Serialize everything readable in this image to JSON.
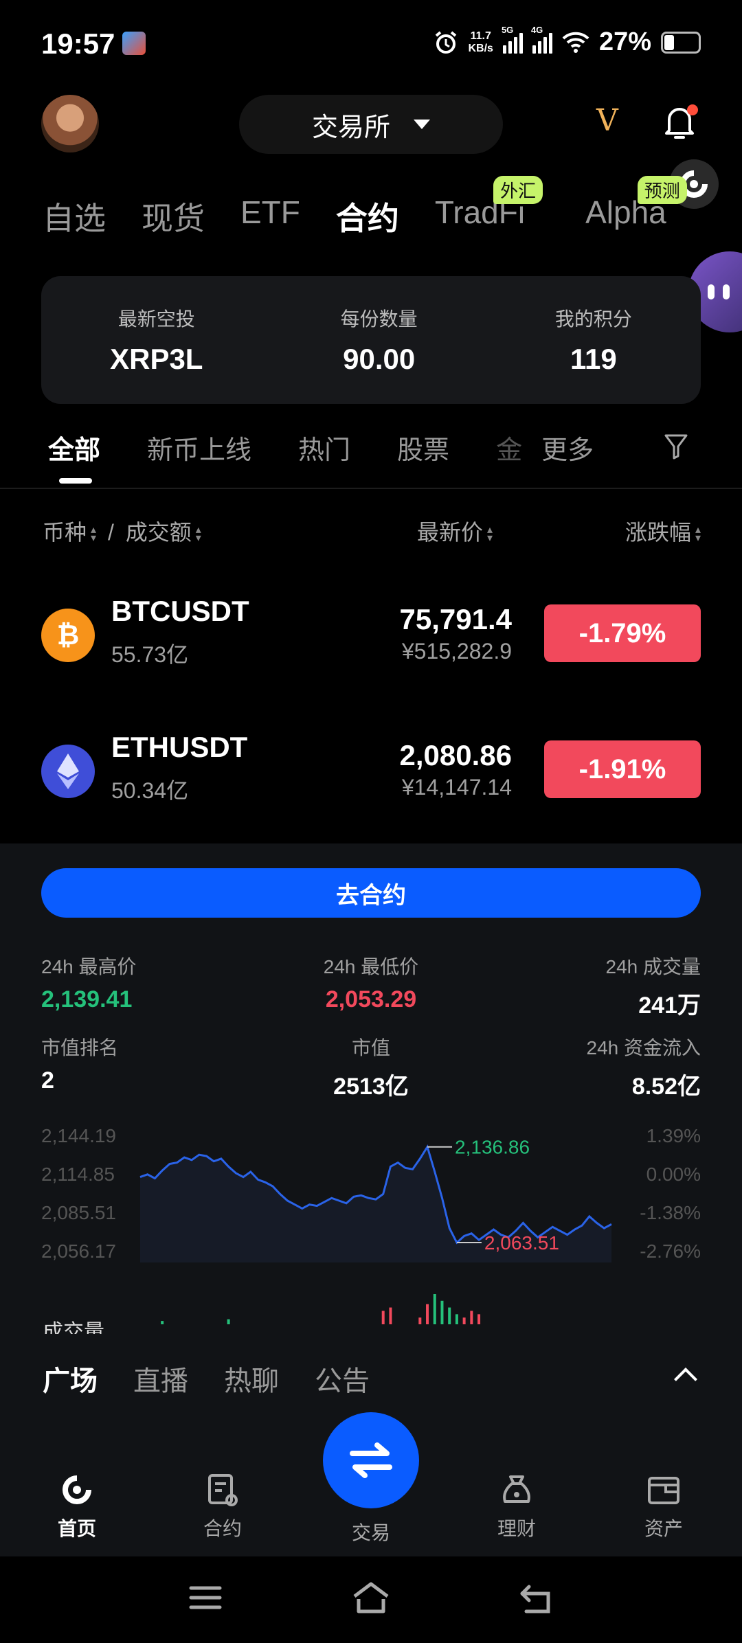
{
  "status_bar": {
    "time": "19:57",
    "net_speed_value": "11.7",
    "net_speed_unit": "KB/s",
    "sig1": "5G",
    "sig2": "4G",
    "battery": "27%"
  },
  "header": {
    "exchange_label": "交易所",
    "brand_mark": "V"
  },
  "market_tabs": [
    {
      "label": "自选"
    },
    {
      "label": "现货"
    },
    {
      "label": "ETF"
    },
    {
      "label": "合约",
      "active": true
    },
    {
      "label": "TradFi",
      "badge": "外汇"
    },
    {
      "label": "Alpha",
      "badge": "预测"
    }
  ],
  "airdrop": {
    "col1_label": "最新空投",
    "col1_value": "XRP3L",
    "col2_label": "每份数量",
    "col2_value": "90.00",
    "col3_label": "我的积分",
    "col3_value": "119"
  },
  "category_tabs": [
    "全部",
    "新币上线",
    "热门",
    "股票",
    "金",
    "更多"
  ],
  "list_header": {
    "coin": "币种",
    "sep": "/",
    "turnover": "成交额",
    "price": "最新价",
    "change": "涨跌幅"
  },
  "rows": [
    {
      "symbol": "BTCUSDT",
      "turnover": "55.73亿",
      "price": "75,791.4",
      "cny": "¥515,282.9",
      "change": "-1.79%"
    },
    {
      "symbol": "ETHUSDT",
      "turnover": "50.34亿",
      "price": "2,080.86",
      "cny": "¥14,147.14",
      "change": "-1.91%"
    }
  ],
  "detail": {
    "go_button": "去合约",
    "high_label": "24h 最高价",
    "high_value": "2,139.41",
    "low_label": "24h 最低价",
    "low_value": "2,053.29",
    "vol_label": "24h 成交量",
    "vol_value": "241万",
    "rank_label": "市值排名",
    "rank_value": "2",
    "cap_label": "市值",
    "cap_value": "2513亿",
    "inflow_label": "24h 资金流入",
    "inflow_value": "8.52亿",
    "volume_title": "成交量"
  },
  "chart_data": {
    "type": "line",
    "y_ticks_left": [
      "2,144.19",
      "2,114.85",
      "2,085.51",
      "2,056.17"
    ],
    "y_ticks_right": [
      "1.39%",
      "0.00%",
      "-1.38%",
      "-2.76%"
    ],
    "ylim": [
      2056.17,
      2144.19
    ],
    "annotations": [
      {
        "label": "2,136.86",
        "kind": "max"
      },
      {
        "label": "2,063.51",
        "kind": "min"
      }
    ],
    "series": [
      {
        "values": [
          2114,
          2116,
          2113,
          2119,
          2124,
          2125,
          2129,
          2127,
          2131,
          2130,
          2126,
          2128,
          2122,
          2117,
          2114,
          2118,
          2112,
          2110,
          2107,
          2101,
          2096,
          2093,
          2090,
          2093,
          2092,
          2095,
          2098,
          2096,
          2094,
          2099,
          2100,
          2098,
          2097,
          2101,
          2122,
          2125,
          2121,
          2120,
          2128,
          2137,
          2118,
          2098,
          2075,
          2064,
          2069,
          2071,
          2066,
          2070,
          2074,
          2070,
          2068,
          2073,
          2079,
          2073,
          2068,
          2072,
          2076,
          2073,
          2070,
          2074,
          2077,
          2084,
          2079,
          2075,
          2078
        ]
      }
    ],
    "volume_bars": [
      {
        "i": 3,
        "v": 2,
        "dir": "up"
      },
      {
        "i": 12,
        "v": 3,
        "dir": "up"
      },
      {
        "i": 33,
        "v": 8,
        "dir": "down"
      },
      {
        "i": 34,
        "v": 10,
        "dir": "down"
      },
      {
        "i": 38,
        "v": 4,
        "dir": "down"
      },
      {
        "i": 39,
        "v": 12,
        "dir": "down"
      },
      {
        "i": 40,
        "v": 18,
        "dir": "up"
      },
      {
        "i": 41,
        "v": 14,
        "dir": "up"
      },
      {
        "i": 42,
        "v": 10,
        "dir": "up"
      },
      {
        "i": 43,
        "v": 6,
        "dir": "up"
      },
      {
        "i": 44,
        "v": 4,
        "dir": "down"
      },
      {
        "i": 45,
        "v": 8,
        "dir": "down"
      },
      {
        "i": 46,
        "v": 6,
        "dir": "down"
      }
    ],
    "colors": {
      "line": "#2a63e8",
      "up": "#25c17b",
      "down": "#f2495c"
    }
  },
  "feed_tabs": [
    "广场",
    "直播",
    "热聊",
    "公告"
  ],
  "bottom_nav": [
    {
      "label": "首页",
      "active": true
    },
    {
      "label": "合约"
    },
    {
      "label": "交易"
    },
    {
      "label": "理财"
    },
    {
      "label": "资产"
    }
  ]
}
